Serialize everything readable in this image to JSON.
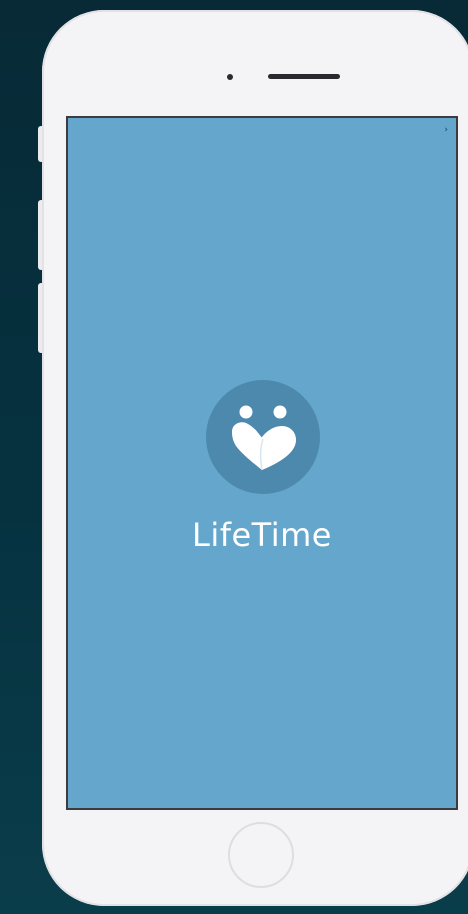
{
  "app": {
    "name": "LifeTime"
  },
  "status": {
    "indicator_glyph": "›"
  },
  "logo": {
    "icon": "heart-with-two-figures-icon",
    "circle_color": "#4d89ad",
    "screen_color": "#64a6cc"
  },
  "device": {
    "frame_color": "#f4f4f6"
  }
}
